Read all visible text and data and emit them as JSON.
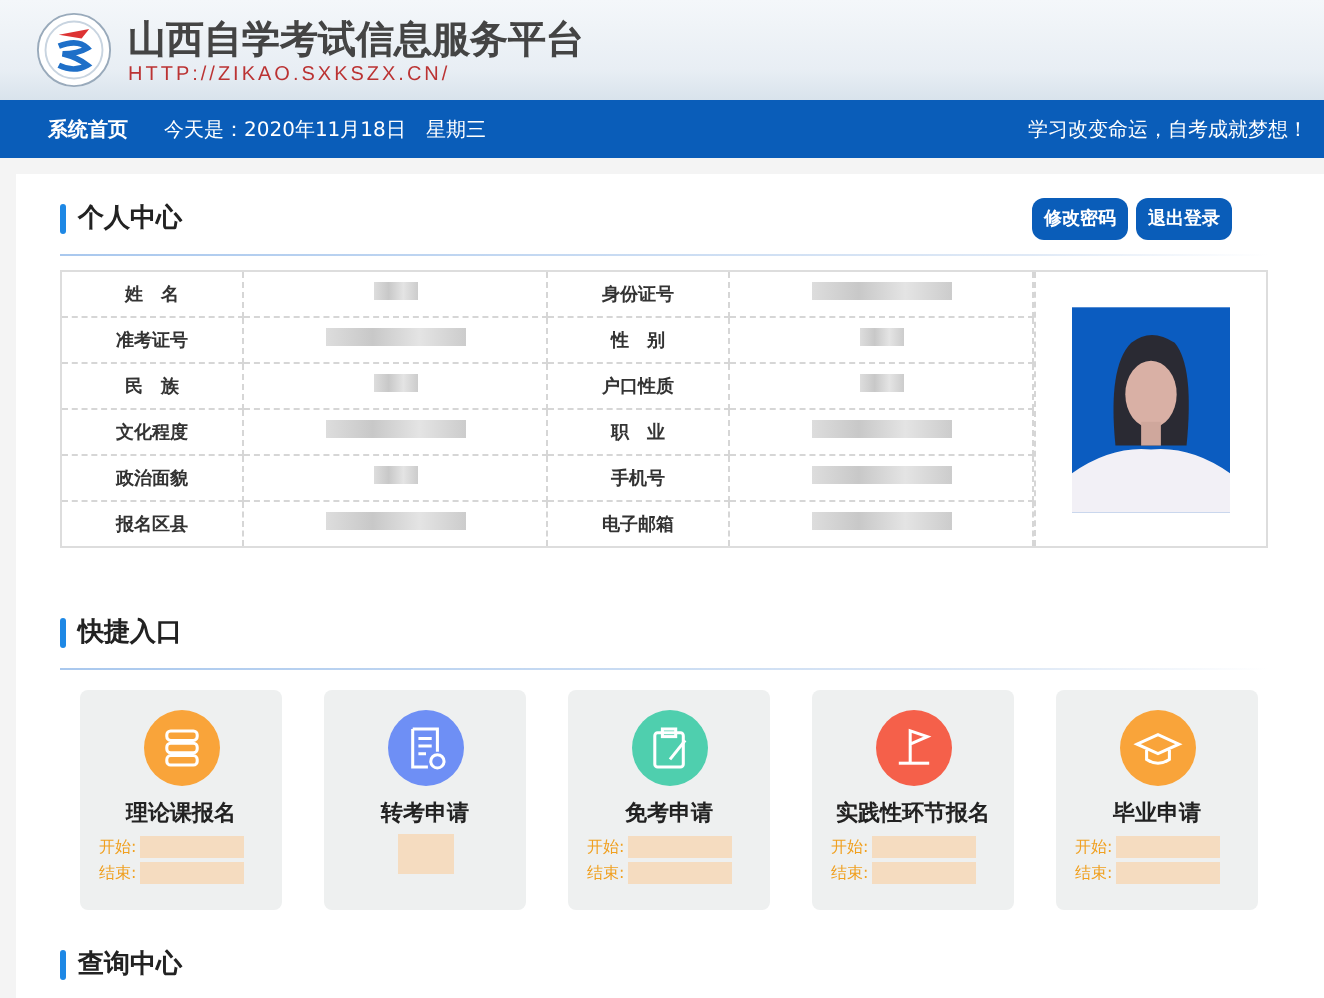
{
  "header": {
    "title": "山西自学考试信息服务平台",
    "url": "HTTP://ZIKAO.SXKSZX.CN/"
  },
  "nav": {
    "home": "系统首页",
    "today_label": "今天是：",
    "date": "2020年11月18日",
    "weekday": "星期三",
    "slogan": "学习改变命运，自考成就梦想！"
  },
  "personal": {
    "title": "个人中心",
    "buttons": [
      "修改密码",
      "退出登录"
    ],
    "fields": [
      {
        "label": "姓　名",
        "kind": "short"
      },
      {
        "label": "身份证号",
        "kind": "long"
      },
      {
        "label": "准考证号",
        "kind": "long"
      },
      {
        "label": "性　别",
        "kind": "short"
      },
      {
        "label": "民　族",
        "kind": "short"
      },
      {
        "label": "户口性质",
        "kind": "short"
      },
      {
        "label": "文化程度",
        "kind": "long"
      },
      {
        "label": "职　业",
        "kind": "long"
      },
      {
        "label": "政治面貌",
        "kind": "short"
      },
      {
        "label": "手机号",
        "kind": "long"
      },
      {
        "label": "报名区县",
        "kind": "long"
      },
      {
        "label": "电子邮箱",
        "kind": "long"
      }
    ]
  },
  "quick": {
    "title": "快捷入口",
    "items": [
      {
        "label": "理论课报名",
        "kind": "books",
        "color": "#f9a43a",
        "start_label": "开始:",
        "end_label": "结束:"
      },
      {
        "label": "转考申请",
        "kind": "doc",
        "color": "#6e8ff5"
      },
      {
        "label": "免考申请",
        "kind": "clipboard",
        "color": "#4fcfae",
        "start_label": "开始:",
        "end_label": "结束:"
      },
      {
        "label": "实践性环节报名",
        "kind": "flag",
        "color": "#f5604a",
        "start_label": "开始:",
        "end_label": "结束:"
      },
      {
        "label": "毕业申请",
        "kind": "cap",
        "color": "#f9a43a",
        "start_label": "开始:",
        "end_label": "结束:"
      }
    ]
  },
  "query": {
    "title": "查询中心"
  }
}
